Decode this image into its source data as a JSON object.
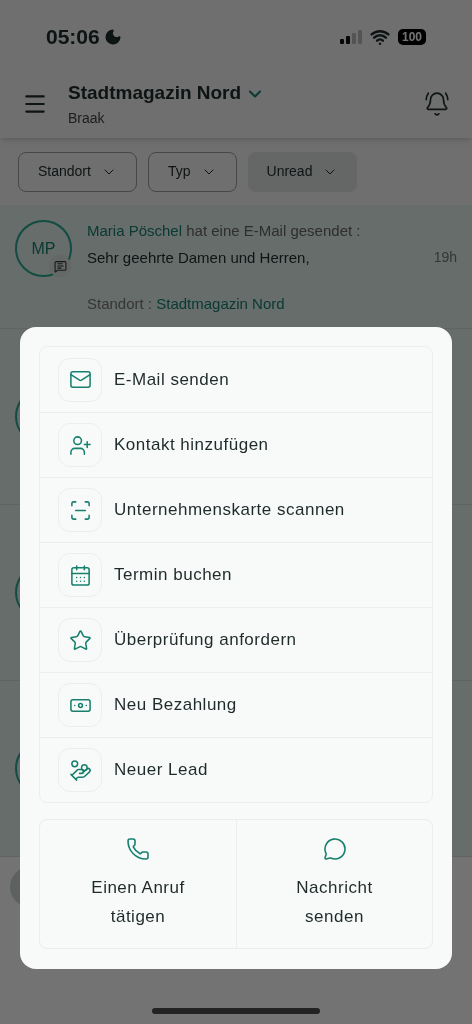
{
  "status_bar": {
    "time": "05:06",
    "battery": "100"
  },
  "header": {
    "title": "Stadtmagazin Nord",
    "subtitle": "Braak"
  },
  "filters": [
    {
      "label": "Standort",
      "selected": false
    },
    {
      "label": "Typ",
      "selected": false
    },
    {
      "label": "Unread",
      "selected": true
    }
  ],
  "notifications": [
    {
      "initials": "MP",
      "sender": "Maria Pöschel",
      "action": "hat eine E-Mail gesendet :",
      "preview": "Sehr geehrte Damen und Herren,",
      "time": "19h",
      "location_label": "Standort :",
      "location": "Stadtmagazin Nord",
      "unread": true
    }
  ],
  "action_sheet": {
    "items": [
      {
        "label": "E-Mail senden"
      },
      {
        "label": "Kontakt hinzufügen"
      },
      {
        "label": "Unternehmenskarte scannen"
      },
      {
        "label": "Termin buchen"
      },
      {
        "label": "Überprüfung anfordern"
      },
      {
        "label": "Neu Bezahlung"
      },
      {
        "label": "Neuer Lead"
      }
    ],
    "quick_actions": [
      {
        "label": "Einen Anruf tätigen"
      },
      {
        "label": "Nachricht senden"
      }
    ]
  }
}
